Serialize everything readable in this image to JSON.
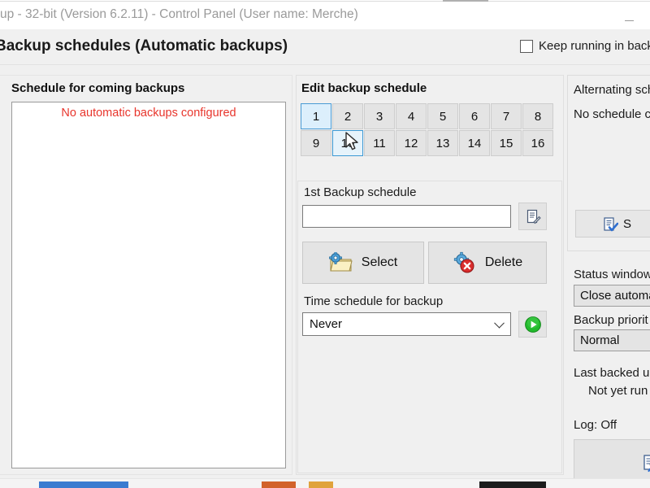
{
  "window": {
    "title": "up - 32-bit (Version 6.2.11) - Control Panel (User name: Merche)",
    "minimize_label": "Minimize"
  },
  "header": {
    "title": "Backup schedules (Automatic backups)",
    "keep_running_label": "Keep running in back",
    "keep_running_checked": false
  },
  "left_panel": {
    "group_label": "Schedule for coming backups",
    "list_message": "No automatic backups configured",
    "message_color": "#e8352c"
  },
  "mid_panel": {
    "group_label": "Edit backup schedule",
    "numbers": [
      "1",
      "2",
      "3",
      "4",
      "5",
      "6",
      "7",
      "8",
      "9",
      "10",
      "11",
      "12",
      "13",
      "14",
      "15",
      "16"
    ],
    "selected_number": "1",
    "hovered_number": "10",
    "schedule_label": "1st  Backup schedule",
    "schedule_value": "",
    "schedule_placeholder": "",
    "edit_icon": "document-edit-icon",
    "select_button": "Select",
    "select_icon": "folder-gear-icon",
    "delete_button": "Delete",
    "delete_icon": "gear-delete-icon",
    "time_label": "Time schedule for backup",
    "time_value": "Never",
    "time_options": [
      "Never"
    ],
    "run_icon": "play-green-icon"
  },
  "right_panel": {
    "alt_group_label": "Alternating sch",
    "alt_message": "No schedule c",
    "alt_button_label": "S",
    "alt_button_icon": "document-check-icon",
    "status_window_label": "Status window",
    "status_window_value": "Close automa",
    "backup_priority_label": "Backup priorit",
    "backup_priority_value": "Normal",
    "last_backed_label": "Last backed u",
    "last_backed_value": "Not yet run",
    "log_label": "Log: Off",
    "log_icon": "document-search-icon"
  },
  "colors": {
    "accent_selected": "#dceffc",
    "accent_border": "#4a9bd4",
    "panel_bg": "#f0f0f0",
    "button_bg": "#e4e4e4",
    "error_text": "#e8352c"
  }
}
